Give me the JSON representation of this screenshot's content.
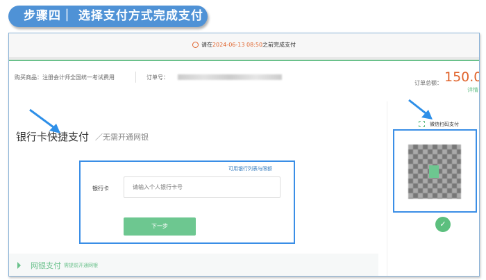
{
  "banner": {
    "title": "步骤四｜ 选择支付方式完成支付"
  },
  "deadline": {
    "prefix": "请在",
    "time": "2024-06-13 08:50",
    "suffix": "之前完成支付"
  },
  "order": {
    "product_label": "购买商品：",
    "product": "注册会计师全国统一考试费用",
    "order_no_label": "订单号：",
    "total_label": "订单总额：",
    "total": "150.00",
    "details_link": "详情"
  },
  "card_pay": {
    "title": "银行卡快捷支付",
    "subtitle": "／无需开通网银",
    "bank_list_link": "可用银行列表与限额",
    "card_label": "银行卡",
    "card_placeholder": "请输入个人银行卡号",
    "next_button": "下一步"
  },
  "netbank": {
    "title": "网银支付",
    "note": "需提前开通网银"
  },
  "wechat": {
    "label": "微信扫码支付"
  },
  "colors": {
    "accent": "#3a8ee6",
    "green": "#6dc790",
    "orange": "#e0632b"
  }
}
